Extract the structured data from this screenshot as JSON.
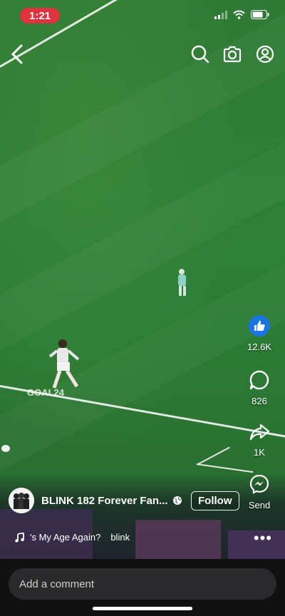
{
  "status_bar": {
    "time": "1:21"
  },
  "video": {
    "overlay_text": "GOAL24"
  },
  "actions": {
    "like": {
      "count": "12.6K",
      "icon": "thumbs-up-icon"
    },
    "comment": {
      "count": "826",
      "icon": "speech-bubble-icon"
    },
    "share": {
      "count": "1K",
      "icon": "share-arrow-icon"
    },
    "send": {
      "label": "Send",
      "icon": "messenger-icon"
    }
  },
  "author": {
    "name": "BLINK 182 Forever Fan...",
    "follow_label": "Follow"
  },
  "music": {
    "track": "'s My Age Again?",
    "artist": "blink"
  },
  "comment_bar": {
    "placeholder": "Add a comment"
  },
  "colors": {
    "time_badge": "#e0333d",
    "like_blue": "#1b74e4",
    "field_green": "#2e7f36"
  }
}
